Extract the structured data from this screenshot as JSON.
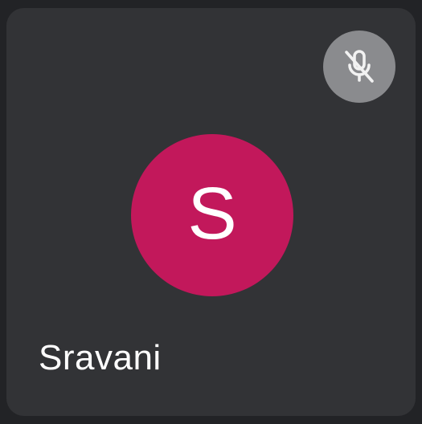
{
  "participant": {
    "name": "Sravani",
    "initial": "S",
    "avatar_color": "#C2185B",
    "mic_status": "muted",
    "mic_icon": "mic-off-icon"
  },
  "colors": {
    "tile_background": "#323336",
    "page_background": "#222326",
    "mic_badge_background": "#8A8B8E"
  }
}
